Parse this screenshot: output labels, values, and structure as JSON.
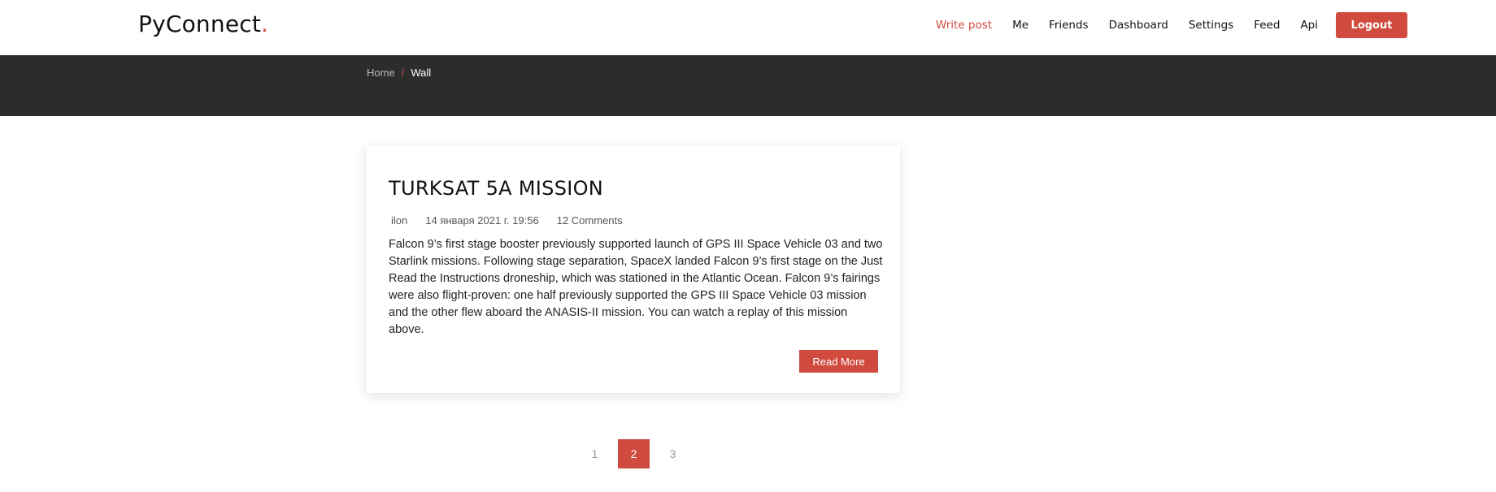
{
  "brand": {
    "name": "PyConnect",
    "dot": ".",
    "accent_color": "#d04a3e"
  },
  "nav": {
    "items": [
      {
        "label": "Write post",
        "active": true
      },
      {
        "label": "Me"
      },
      {
        "label": "Friends"
      },
      {
        "label": "Dashboard"
      },
      {
        "label": "Settings"
      },
      {
        "label": "Feed"
      },
      {
        "label": "Api"
      }
    ],
    "logout_label": "Logout"
  },
  "breadcrumb": {
    "home": "Home",
    "separator": "/",
    "current": "Wall"
  },
  "post": {
    "title": "TURKSAT 5A MISSION",
    "author": "ilon",
    "date": "14 января 2021 г. 19:56",
    "comments": "12 Comments",
    "body": "Falcon 9’s first stage booster previously supported launch of GPS III Space Vehicle 03 and two Starlink missions. Following stage separation, SpaceX landed Falcon 9’s first stage on the Just Read the Instructions droneship, which was stationed in the Atlantic Ocean. Falcon 9’s fairings were also flight-proven: one half previously supported the GPS III Space Vehicle 03 mission and the other flew aboard the ANASIS-II mission. You can watch a replay of this mission above.",
    "read_more_label": "Read More"
  },
  "pagination": {
    "pages": [
      "1",
      "2",
      "3"
    ],
    "current": "2"
  },
  "colors": {
    "banner_bg": "#2c2c2c",
    "accent": "#d04a3e"
  }
}
